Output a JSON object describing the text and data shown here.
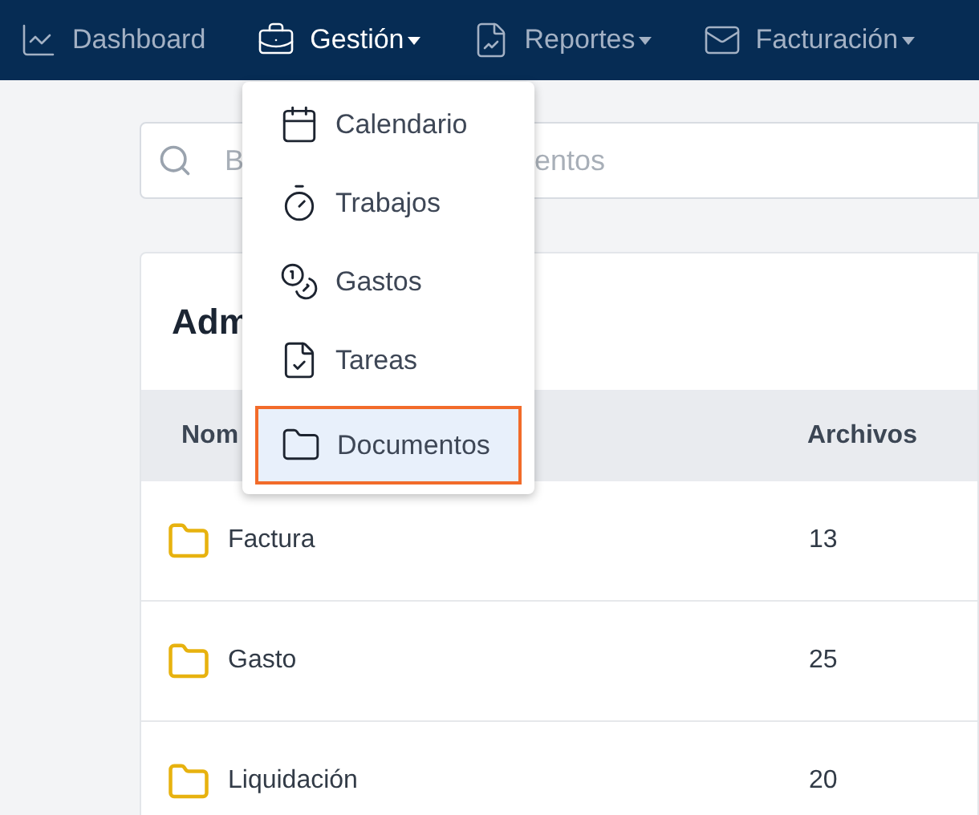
{
  "nav": [
    {
      "label": "Dashboard",
      "kind": "chart",
      "dropdown": false,
      "selected": false
    },
    {
      "label": "Gestión",
      "kind": "briefcase",
      "dropdown": true,
      "selected": true
    },
    {
      "label": "Reportes",
      "kind": "report",
      "dropdown": true,
      "selected": false
    },
    {
      "label": "Facturación",
      "kind": "invoice",
      "dropdown": true,
      "selected": false
    }
  ],
  "menu": [
    {
      "label": "Calendario",
      "kind": "calendar",
      "selected": false
    },
    {
      "label": "Trabajos",
      "kind": "timer",
      "selected": false
    },
    {
      "label": "Gastos",
      "kind": "coins",
      "selected": false
    },
    {
      "label": "Tareas",
      "kind": "task",
      "selected": false
    },
    {
      "label": "Documentos",
      "kind": "folder",
      "selected": true
    }
  ],
  "search": {
    "placeholder": "B",
    "placeholder_tail": "entos"
  },
  "card": {
    "title": "Adm"
  },
  "table": {
    "columns": [
      "Nom",
      "Archivos"
    ],
    "rows": [
      {
        "name": "Factura",
        "files": "13"
      },
      {
        "name": "Gasto",
        "files": "25"
      },
      {
        "name": "Liquidación",
        "files": "20"
      }
    ]
  }
}
